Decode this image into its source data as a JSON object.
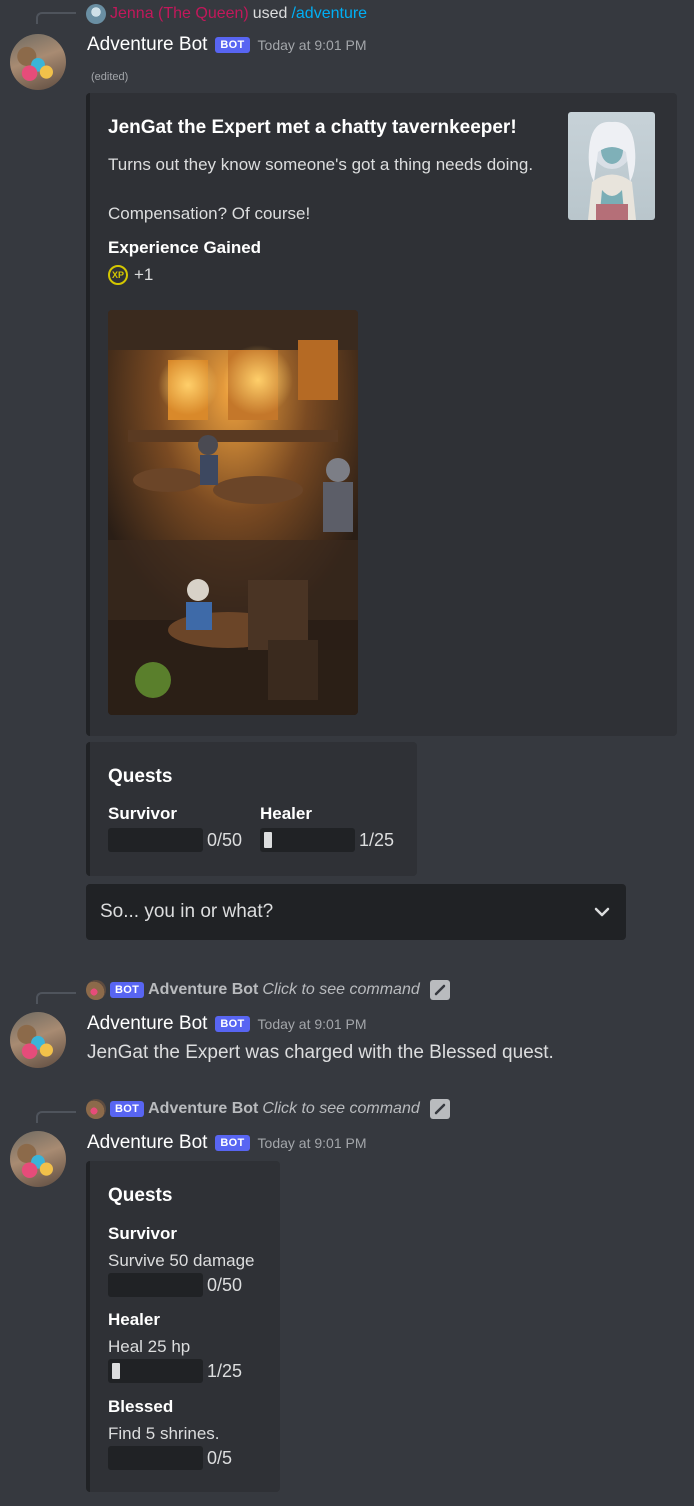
{
  "messages": [
    {
      "reference": {
        "user": "Jenna (The Queen)",
        "verb": "used",
        "command": "/adventure"
      },
      "author": "Adventure Bot",
      "bot_tag": "BOT",
      "time": "Today at 9:01 PM",
      "edited": "(edited)",
      "embed": {
        "title": "JenGat the Expert met a chatty tavernkeeper!",
        "description_line1": "Turns out they know someone's got a thing needs doing.",
        "description_line2": "Compensation? Of course!",
        "field_name": "Experience Gained",
        "xp_icon_label": "XP",
        "xp_value": "+1"
      },
      "quests_embed": {
        "title": "Quests",
        "quests": [
          {
            "name": "Survivor",
            "progress": "0/50",
            "fraction": 0.0
          },
          {
            "name": "Healer",
            "progress": "1/25",
            "fraction": 0.04
          }
        ]
      },
      "select": {
        "placeholder": "So... you in or what?"
      }
    },
    {
      "reference": {
        "bot_tag": "BOT",
        "user": "Adventure Bot",
        "command_hint": "Click to see command"
      },
      "author": "Adventure Bot",
      "bot_tag": "BOT",
      "time": "Today at 9:01 PM",
      "content": "JenGat the Expert was charged with the Blessed quest."
    },
    {
      "reference": {
        "bot_tag": "BOT",
        "user": "Adventure Bot",
        "command_hint": "Click to see command"
      },
      "author": "Adventure Bot",
      "bot_tag": "BOT",
      "time": "Today at 9:01 PM",
      "quests_embed": {
        "title": "Quests",
        "quests": [
          {
            "name": "Survivor",
            "description": "Survive 50 damage",
            "progress": "0/50",
            "fraction": 0.0
          },
          {
            "name": "Healer",
            "description": "Heal 25 hp",
            "progress": "1/25",
            "fraction": 0.04
          },
          {
            "name": "Blessed",
            "description": "Find 5 shrines.",
            "progress": "0/5",
            "fraction": 0.0
          }
        ]
      }
    }
  ],
  "colors": {
    "background": "#36393f",
    "embed_bg": "#2f3136",
    "bot_tag": "#5865f2",
    "reference_user": "#c2185b",
    "command_link": "#00aff4"
  }
}
